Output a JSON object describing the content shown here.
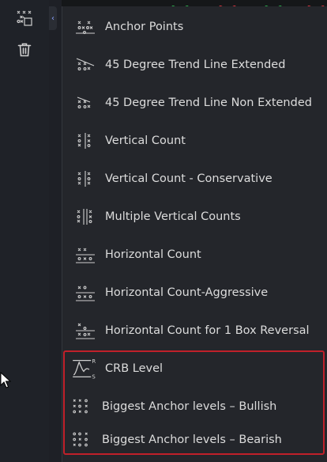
{
  "toolbar": {
    "items": [
      {
        "icon": "point-figure-tools-icon"
      },
      {
        "icon": "trash-icon"
      }
    ],
    "collapse_icon": "chevron-left-icon",
    "collapse_glyph": "‹"
  },
  "menu": {
    "items": [
      {
        "label": "Anchor Points",
        "icon": "anchor-points-icon"
      },
      {
        "label": "45 Degree Trend Line Extended",
        "icon": "trend-line-extended-icon"
      },
      {
        "label": "45 Degree Trend Line Non Extended",
        "icon": "trend-line-non-extended-icon"
      },
      {
        "label": "Vertical Count",
        "icon": "vertical-count-icon"
      },
      {
        "label": "Vertical Count - Conservative",
        "icon": "vertical-count-conservative-icon"
      },
      {
        "label": "Multiple Vertical Counts",
        "icon": "multiple-vertical-counts-icon"
      },
      {
        "label": "Horizontal Count",
        "icon": "horizontal-count-icon"
      },
      {
        "label": "Horizontal Count-Aggressive",
        "icon": "horizontal-count-aggressive-icon"
      },
      {
        "label": "Horizontal Count for 1 Box Reversal",
        "icon": "horizontal-count-1-box-icon"
      },
      {
        "label": "CRB Level",
        "icon": "crb-level-icon",
        "icon_text": [
          "R",
          "S"
        ]
      },
      {
        "label": "Biggest Anchor levels – Bullish",
        "icon": "anchor-bullish-icon"
      },
      {
        "label": "Biggest Anchor levels – Bearish",
        "icon": "anchor-bearish-icon"
      }
    ]
  },
  "colors": {
    "highlight_border": "#c0202a",
    "menu_bg": "#24262b",
    "toolbar_bg": "#1f2228",
    "text": "#dcdcdc"
  }
}
